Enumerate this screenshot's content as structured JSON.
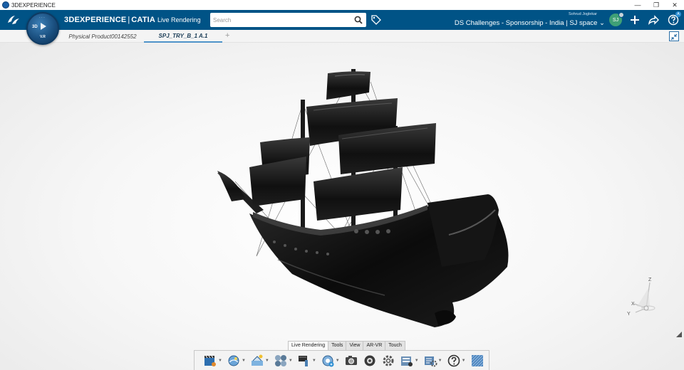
{
  "window": {
    "os_title": "3DEXPERIENCE",
    "minimize": "—",
    "maximize": "❐",
    "close": "✕"
  },
  "header": {
    "brand_main": "3DEXPERIENCE",
    "brand_sep": "|",
    "brand_app": "CATIA",
    "brand_sub": "Live Rendering",
    "compass_label": "3D",
    "compass_vr": "V.R",
    "search_placeholder": "Search",
    "user_name": "Sohrud Joglekar",
    "space": "DS Challenges - Sponsorship - India | SJ space ⌄",
    "avatar_initials": "SJ",
    "help_badge": "A"
  },
  "tabs": [
    {
      "label": "Physical Product00142552",
      "active": false
    },
    {
      "label": "SPJ_TRY_B_1 A.1",
      "active": true
    }
  ],
  "tab_add": "+",
  "triad": {
    "x": "X",
    "y": "Y",
    "z": "Z"
  },
  "action_bar": {
    "tabs": [
      {
        "label": "Live Rendering",
        "active": true
      },
      {
        "label": "Tools",
        "active": false
      },
      {
        "label": "View",
        "active": false
      },
      {
        "label": "AR-VR",
        "active": false
      },
      {
        "label": "Touch",
        "active": false
      }
    ],
    "icons": [
      {
        "name": "animation-icon",
        "caret": true
      },
      {
        "name": "render-environment-icon",
        "caret": true
      },
      {
        "name": "lighting-icon",
        "caret": true
      },
      {
        "name": "materials-icon",
        "caret": true
      },
      {
        "name": "paint-icon",
        "caret": true
      },
      {
        "name": "camera-add-icon",
        "caret": true
      },
      {
        "name": "capture-icon",
        "caret": false
      },
      {
        "name": "render-icon",
        "caret": false
      },
      {
        "name": "settings-icon",
        "caret": false
      },
      {
        "name": "database-icon",
        "caret": true
      },
      {
        "name": "tools-icon",
        "caret": true
      },
      {
        "name": "help-icon",
        "caret": true
      },
      {
        "name": "texture-icon",
        "caret": false
      }
    ]
  },
  "colors": {
    "topbar": "#005386",
    "accent": "#4f93c9",
    "ship": "#111111"
  }
}
